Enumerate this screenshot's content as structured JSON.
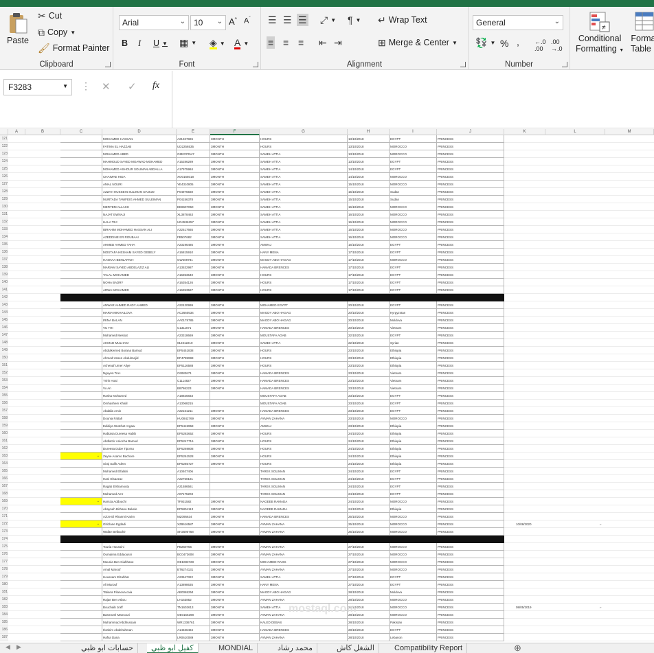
{
  "ribbon": {
    "clipboard": {
      "paste": "Paste",
      "cut": "Cut",
      "copy": "Copy",
      "format_painter": "Format Painter",
      "label": "Clipboard"
    },
    "font": {
      "name": "Arial",
      "size": "10",
      "bold": "B",
      "italic": "I",
      "underline": "U",
      "label": "Font"
    },
    "alignment": {
      "wrap": "Wrap Text",
      "merge": "Merge & Center",
      "label": "Alignment"
    },
    "number": {
      "format": "General",
      "percent": "%",
      "comma": ",",
      "label": "Number"
    },
    "styles": {
      "conditional": "Conditional",
      "formatting": "Formatting",
      "format_as": "Format",
      "table": "Table"
    }
  },
  "formula_bar": {
    "name_box": "F3283",
    "fx": "fx",
    "cancel": "✕",
    "enter": "✓",
    "content": ""
  },
  "columns": [
    "A",
    "B",
    "C",
    "D",
    "E",
    "F",
    "G",
    "H",
    "I",
    "J",
    "K",
    "L",
    "M"
  ],
  "selected_column": "F",
  "rows": [
    {
      "n": "121",
      "d": "MOHAMED HASSAN",
      "e": "A21327826",
      "f": "3MONTH",
      "g": "HOURS",
      "h": "13/10/2018",
      "i": "EGYPT",
      "j": "PRINCESS"
    },
    {
      "n": "122",
      "d": "FATIMA EL HAZZAB",
      "e": "UD2256535",
      "f": "3MONTH",
      "g": "HOURS",
      "h": "13/10/2018",
      "i": "MOROCCO",
      "j": "PRINCESS"
    },
    {
      "n": "123",
      "d": "MOHAMED ABED",
      "e": "GM0372547",
      "f": "3MONTH",
      "g": "SAMEH ATTIA",
      "h": "13/10/2018",
      "i": "MOROCCO",
      "j": "PRINCESS"
    },
    {
      "n": "124",
      "d": "MAHMOUD SAYED MOAWAD MOHAMED",
      "e": "A15286289",
      "f": "3MONTH",
      "g": "SAMEH ATTIA",
      "h": "13/10/2018",
      "i": "EGYPT",
      "j": "PRINCESS"
    },
    {
      "n": "125",
      "d": "MOHAMED ASHOUR SOLIMAN ABDALLA",
      "e": "A17975984",
      "f": "3MONTH",
      "g": "SAMEH ATTIA",
      "h": "14/10/2018",
      "i": "EGYPT",
      "j": "PRINCESS"
    },
    {
      "n": "126",
      "d": "CHAIMAE HIDA",
      "e": "XO0165018",
      "f": "3MONTH",
      "g": "SAMEH ATTIA",
      "h": "14/10/2018",
      "i": "MOROCCO",
      "j": "PRINCESS"
    },
    {
      "n": "127",
      "d": "AMAL NOURI",
      "e": "YE4310805",
      "f": "3MONTH",
      "g": "SAMEH ATTIA",
      "h": "15/10/2018",
      "i": "MOROCCO",
      "j": "PRINCESS"
    },
    {
      "n": "128",
      "d": "AZZAH HUSSEIN SULIMAN DAOUD",
      "e": "P04975560",
      "f": "3MONTH",
      "g": "SAMEH ATTIA",
      "h": "15/10/2018",
      "i": "Sudan",
      "j": "PRINCESS"
    },
    {
      "n": "129",
      "d": "MURTADA TAWFEIG AHMED SULEIMAN",
      "e": "P04156378",
      "f": "3MONTH",
      "g": "SAMEH ATTIA",
      "h": "15/10/2018",
      "i": "Sudan",
      "j": "PRINCESS"
    },
    {
      "n": "130",
      "d": "MERYEM ALLACH",
      "e": "EE8607050",
      "f": "3MONTH",
      "g": "SAMEH ATTIA",
      "h": "16/10/2018",
      "i": "MOROCCO",
      "j": "PRINCESS"
    },
    {
      "n": "131",
      "d": "NAJAT EWNAJI",
      "e": "XL3878463",
      "f": "3MONTH",
      "g": "SAMEH ATTIA",
      "h": "16/10/2018",
      "i": "MOROCCO",
      "j": "PRINCESS"
    },
    {
      "n": "132",
      "d": "HALA TEJ",
      "e": "UD4536257",
      "f": "3MONTH",
      "g": "SAMEH ATTIA",
      "h": "16/10/2018",
      "i": "MOROCCO",
      "j": "PRINCESS"
    },
    {
      "n": "133",
      "d": "IBRAHIM MOHAMED HASSAN ALI",
      "e": "A22517665",
      "f": "3MONTH",
      "g": "SAMEH ATTIA",
      "h": "16/10/2018",
      "i": "MOROCCO",
      "j": "PRINCESS"
    },
    {
      "n": "134",
      "d": "AZEDDINE ER ROUBAAI",
      "e": "FB507682",
      "f": "3MONTH",
      "g": "SAMEH ATTIA",
      "h": "16/10/2018",
      "i": "MOROCCO",
      "j": "PRINCESS"
    },
    {
      "n": "135",
      "d": "AHMED AHMED TAHA",
      "e": "A23196485",
      "f": "3MONTH",
      "g": "AMWAJ",
      "h": "16/10/2018",
      "i": "EGYPT",
      "j": "PRINCESS"
    },
    {
      "n": "136",
      "d": "MOSTAFA HESHAM SAYED GEBELY",
      "e": "A16815910",
      "f": "3MONTH",
      "g": "HANY MENA",
      "h": "17/10/2018",
      "i": "EGYPT",
      "j": "PRINCESS"
    },
    {
      "n": "137",
      "d": "HASNAA BENLAFKIH",
      "e": "GW209781",
      "f": "3MONTH",
      "g": "MAGDY ABO HAGAG",
      "h": "17/10/2018",
      "i": "MOROCCO",
      "j": "PRINCESS"
    },
    {
      "n": "138",
      "d": "MARIAM SAYED ABDELAZIZ ALI",
      "e": "A13532987",
      "f": "3MONTH",
      "g": "HAMADA BRENCES",
      "h": "17/10/2018",
      "i": "EGYPT",
      "j": "PRINCESS"
    },
    {
      "n": "139",
      "d": "TALAL MOHAMED",
      "e": "A16353640",
      "f": "3MONTH",
      "g": "HOURS",
      "h": "17/10/2018",
      "i": "EGYPT",
      "j": "PRINCESS"
    },
    {
      "n": "140",
      "d": "NOHA BADRY",
      "e": "A16354126",
      "f": "3MONTH",
      "g": "HOURS",
      "h": "17/10/2018",
      "i": "EGYPT",
      "j": "PRINCESS"
    },
    {
      "n": "141",
      "d": "ARWA MOHAMED",
      "e": "A16353597",
      "f": "3MONTH",
      "g": "HOURS",
      "h": "17/10/2018",
      "i": "EGYPT",
      "j": "PRINCESS"
    },
    {
      "n": "142",
      "black": true
    },
    {
      "n": "143",
      "d": "ANWAR AHMED RADY AHMED",
      "e": "A22420999",
      "f": "3MONTH",
      "g": "MOHAMED EGYPT",
      "h": "20/10/2018",
      "i": "EGYPT",
      "j": "PRINCESS"
    },
    {
      "n": "144",
      "d": "MARIA MIKHAILOVA",
      "e": "AC2660534",
      "f": "3MONTH",
      "g": "MAGDY ABO HAGAG",
      "h": "20/10/2018",
      "i": "Kyrgyzstan",
      "j": "PRINCESS"
    },
    {
      "n": "145",
      "d": "IRINA BALAN",
      "e": "AA0178785",
      "f": "3MONTH",
      "g": "MAGDY ABO HAGAG",
      "h": "20/10/2018",
      "i": "Moldova",
      "j": "PRINCESS"
    },
    {
      "n": "146",
      "d": "VU THI",
      "e": "C1311071",
      "f": "3MONTH",
      "g": "HAMADA BRENCES",
      "h": "20/10/2018",
      "i": "Vietnam",
      "j": "PRINCESS"
    },
    {
      "n": "147",
      "d": "Mohamed Meskat",
      "e": "A23318669",
      "f": "3MONTH",
      "g": "MOUSTAFA AGAB",
      "h": "22/10/2018",
      "i": "EGYPT",
      "j": "PRINCESS"
    },
    {
      "n": "148",
      "d": "AHMAD MULHAM",
      "e": "012312210",
      "f": "3MONTH",
      "g": "SAMEH ATTIA",
      "h": "22/10/2018",
      "i": "Syrian",
      "j": "PRINCESS"
    },
    {
      "n": "149",
      "d": "Abdulkerned Borana Bamud",
      "e": "EP5451838",
      "f": "3MONTH",
      "g": "HOURS",
      "h": "23/10/2018",
      "i": "Ethiopia",
      "j": "PRINCESS"
    },
    {
      "n": "150",
      "d": "Ahmed Ussen Abdulmejid",
      "e": "EP4785998",
      "f": "3MONTH",
      "g": "HOURS",
      "h": "23/10/2018",
      "i": "Ethiopia",
      "j": "PRINCESS"
    },
    {
      "n": "151",
      "d": "Achenaf Umer Aliye",
      "e": "EP5116588",
      "f": "3MONTH",
      "g": "HOURS",
      "h": "23/10/2018",
      "i": "Ethiopia",
      "j": "PRINCESS"
    },
    {
      "n": "152",
      "d": "Nguyen Truc",
      "e": "C6082671",
      "f": "3MONTH",
      "g": "HAMADA BRENCES",
      "h": "23/10/2018",
      "i": "Vietnam",
      "j": "PRINCESS"
    },
    {
      "n": "153",
      "d": "Trinh Hoai",
      "e": "C1114827",
      "f": "3MONTH",
      "g": "HAMADA BRENCES",
      "h": "23/10/2018",
      "i": "Vietnam",
      "j": "PRINCESS"
    },
    {
      "n": "154",
      "d": "Vo An",
      "e": "B8786223",
      "f": "3MONTH",
      "g": "HAMADA BRENCES",
      "h": "23/10/2018",
      "i": "Vietnam",
      "j": "PRINCESS"
    },
    {
      "n": "155",
      "d": "Rasha Mohamed",
      "e": "A18826833",
      "f": "",
      "g": "MOUSTAFA AGAB",
      "h": "23/10/2018",
      "i": "EGYPT",
      "j": "PRINCESS"
    },
    {
      "n": "156",
      "d": "Omhashem Khalil",
      "e": "A13068215",
      "f": "",
      "g": "MOUSTAFA AGAB",
      "h": "23/10/2018",
      "i": "EGYPT",
      "j": "PRINCESS"
    },
    {
      "n": "157",
      "d": "Abdalla Amin",
      "e": "A22161211",
      "f": "3MONTH",
      "g": "HAMADA BRENCES",
      "h": "23/10/2018",
      "i": "EGYPT",
      "j": "PRINCESS"
    },
    {
      "n": "158",
      "d": "Dounia Fattah",
      "e": "HU0842769",
      "f": "3MONTH",
      "g": "AYMAN ZAHANA",
      "h": "23/10/2018",
      "i": "MOROCCO",
      "j": "PRINCESS"
    },
    {
      "n": "159",
      "d": "Edidiya Wutchet Argaw",
      "e": "EP5415958",
      "f": "3MONTH",
      "g": "AMWAJ",
      "h": "23/10/2018",
      "i": "Ethiopia",
      "j": "PRINCESS"
    },
    {
      "n": "160",
      "d": "Habtasa Dureesa Habib",
      "e": "EP5283652",
      "f": "3MONTH",
      "g": "HOURS",
      "h": "24/10/2018",
      "i": "Ethiopia",
      "j": "PRINCESS"
    },
    {
      "n": "161",
      "d": "Abdlarzir Aniocha Bamud",
      "e": "EP5247716",
      "f": "3MONTH",
      "g": "HOURS",
      "h": "24/10/2018",
      "i": "Ethiopia",
      "j": "PRINCESS"
    },
    {
      "n": "162",
      "d": "Dureesa Dube Tiporso",
      "e": "EP5269808",
      "f": "3MONTH",
      "g": "HOURS",
      "h": "24/10/2018",
      "i": "Ethiopia",
      "j": "PRINCESS"
    },
    {
      "n": "163",
      "d": "Zeyne Asamo Bachore",
      "e": "EP5261528",
      "f": "3MONTH",
      "g": "HOURS",
      "h": "24/10/2018",
      "i": "Ethiopia",
      "j": "PRINCESS",
      "yel": true
    },
    {
      "n": "164",
      "d": "Siraj Salih Adem",
      "e": "EP5285727",
      "f": "3MONTH",
      "g": "HOURS",
      "h": "24/10/2018",
      "i": "Ethiopia",
      "j": "PRINCESS"
    },
    {
      "n": "165",
      "d": "Mohamed Elfalahi",
      "e": "A10407406",
      "f": "",
      "g": "TAREK SOLIMAN",
      "h": "24/10/2018",
      "i": "EGYPT",
      "j": "PRINCESS"
    },
    {
      "n": "166",
      "d": "Hani Elsazzaz",
      "e": "A22750181",
      "f": "",
      "g": "TAREK SOLIMAN",
      "h": "24/10/2018",
      "i": "EGYPT",
      "j": "PRINCESS"
    },
    {
      "n": "167",
      "d": "Ragab Elshamouty",
      "e": "A21586561",
      "f": "",
      "g": "TAREK SOLIMAN",
      "h": "24/10/2018",
      "i": "EGYPT",
      "j": "PRINCESS"
    },
    {
      "n": "168",
      "d": "Mohamed Amr",
      "e": "A07175203",
      "f": "",
      "g": "TAREK SOLIMAN",
      "h": "24/10/2018",
      "i": "EGYPT",
      "j": "PRINCESS"
    },
    {
      "n": "169",
      "d": "Hamza Addouchi",
      "e": "TF931582",
      "f": "3MONTH",
      "g": "NAGEEB RAMADA",
      "h": "24/10/2018",
      "i": "MOROCCO",
      "j": "PRINCESS",
      "yel": true
    },
    {
      "n": "170",
      "d": "Abayneh Birhanu Bekele",
      "e": "EP5804113",
      "f": "3MONTH",
      "g": "NAGEEB RAMADA",
      "h": "24/10/2018",
      "i": "Ethiopia",
      "j": "PRINCESS"
    },
    {
      "n": "171",
      "d": "Azize El Rhanmi Karim",
      "e": "MZ095634",
      "f": "3MONTH",
      "g": "HAMADA BRENCES",
      "h": "25/10/2018",
      "i": "MOROCCO",
      "j": "PRINCESS"
    },
    {
      "n": "172",
      "d": "Ghizlane Egdadi",
      "e": "XZ8616587",
      "f": "3MONTH",
      "g": "AYMAN ZAHANA",
      "h": "25/10/2018",
      "i": "MOROCCO",
      "j": "PRINCESS",
      "yel": true
    },
    {
      "n": "173",
      "d": "Wafae Belbachir",
      "e": "SH2590758",
      "f": "3MONTH",
      "g": "AYMAN ZAHANA",
      "h": "25/10/2018",
      "i": "MOROCCO",
      "j": "PRINCESS"
    },
    {
      "n": "174",
      "black": true
    },
    {
      "n": "175",
      "d": "Touria Houssini",
      "e": "PB260756",
      "f": "3MONTH",
      "g": "AYMAN ZAHANA",
      "h": "27/10/2018",
      "i": "MOROCCO",
      "j": "PRINCESS"
    },
    {
      "n": "176",
      "d": "Oumaima Eddaoussi",
      "e": "BC0473608",
      "f": "3MONTH",
      "g": "AYMAN ZAHANA",
      "h": "27/10/2018",
      "i": "MOROCCO",
      "j": "PRINCESS"
    },
    {
      "n": "177",
      "d": "Mounia Ben Ciahhane",
      "e": "OE1083728",
      "f": "3MONTH",
      "g": "MOHAMED RAGS",
      "h": "27/10/2018",
      "i": "MOROCCO",
      "j": "PRINCESS"
    },
    {
      "n": "178",
      "d": "Amal Marouf",
      "e": "BT6274131",
      "f": "3MONTH",
      "g": "AYMAN ZAHANA",
      "h": "27/10/2018",
      "i": "MOROCCO",
      "j": "PRINCESS"
    },
    {
      "n": "179",
      "d": "Houssam Elzahhar",
      "e": "A23547322",
      "f": "3MONTH",
      "g": "SAMEH ATTIA",
      "h": "27/10/2018",
      "i": "EGYPT",
      "j": "PRINCESS"
    },
    {
      "n": "180",
      "d": "Ali Marouf",
      "e": "A13898635",
      "f": "3MONTH",
      "g": "HANY MENA",
      "h": "27/10/2018",
      "i": "EGYPT",
      "j": "PRINCESS"
    },
    {
      "n": "181",
      "d": "Tatiana Filanova.caia",
      "e": "AB0065254",
      "f": "3MONTH",
      "g": "MAGDY ABO HAGAG",
      "h": "28/10/2018",
      "i": "Moldova",
      "j": "PRINCESS"
    },
    {
      "n": "182",
      "d": "Rajae Ben Atbou",
      "e": "LH153852",
      "f": "3MONTH",
      "g": "AYMAN ZAHANA",
      "h": "28/10/2018",
      "i": "MOROCCO",
      "j": "PRINCESS"
    },
    {
      "n": "183",
      "d": "Bouchaib Jraff",
      "e": "TN1602613",
      "f": "3MONTH",
      "g": "SAMEH ATTIA",
      "h": "28/10/2018",
      "i": "MOROCCO",
      "j": "PRINCESS"
    },
    {
      "n": "184",
      "d": "Basma El Mansouri",
      "e": "OE0156298",
      "f": "3MONTH",
      "g": "AYMAN ZAHANA",
      "h": "28/10/2018",
      "i": "MOROCCO",
      "j": "PRINCESS"
    },
    {
      "n": "185",
      "d": "Muhammad Abdhussain",
      "e": "WR1336761",
      "f": "3MONTH",
      "g": "KALED DEBAS",
      "h": "28/10/2018",
      "i": "Pakistan",
      "j": "PRINCESS"
    },
    {
      "n": "186",
      "d": "Ibrahim Abdelrahman",
      "e": "A14536484",
      "f": "3MONTH",
      "g": "HAMADA BRENCES",
      "h": "28/10/2018",
      "i": "EGYPT",
      "j": "PRINCESS"
    },
    {
      "n": "187",
      "d": "Hafsa Dana",
      "e": "LR0610089",
      "f": "3MONTH",
      "g": "AYMAN ZAHANA",
      "h": "28/10/2018",
      "i": "Lebanon",
      "j": "PRINCESS"
    }
  ],
  "side_notes": [
    {
      "row": "172",
      "text": "10/08/2020"
    },
    {
      "row": "183",
      "text": "08/05/2019"
    }
  ],
  "tabs": [
    "حسابات ابو ظبي",
    "كفيل ابو ظبي",
    "MONDIAL",
    "محمد رشاد",
    "الشغل كاش",
    "Compatibility Report"
  ],
  "active_tab": "كفيل ابو ظبي",
  "watermark": "mostaql.com"
}
